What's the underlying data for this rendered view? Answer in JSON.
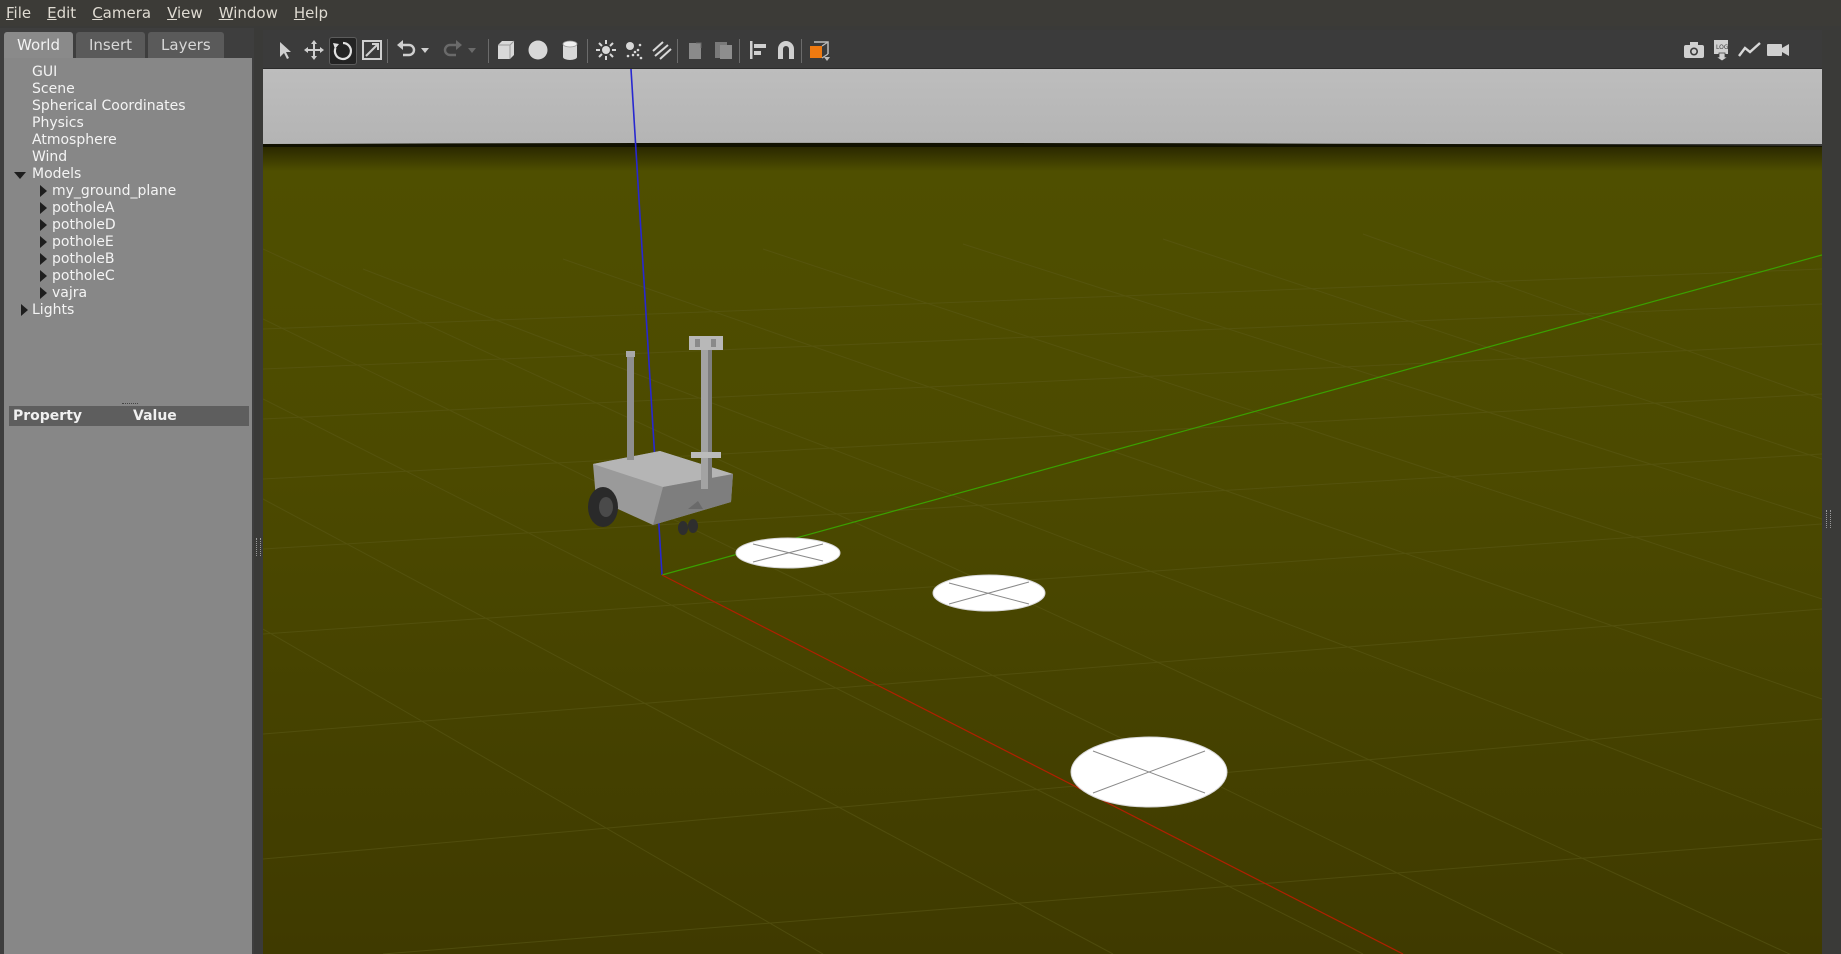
{
  "menu": [
    "File",
    "Edit",
    "Camera",
    "View",
    "Window",
    "Help"
  ],
  "left_panel": {
    "tabs": [
      "World",
      "Insert",
      "Layers"
    ],
    "active_tab": "World",
    "tree": {
      "gui": "GUI",
      "scene": "Scene",
      "spherical": "Spherical Coordinates",
      "physics": "Physics",
      "atmosphere": "Atmosphere",
      "wind": "Wind",
      "models": "Models",
      "model_items": [
        "my_ground_plane",
        "potholeA",
        "potholeD",
        "potholeE",
        "potholeB",
        "potholeC",
        "vajra"
      ],
      "lights": "Lights"
    },
    "property_header": {
      "property": "Property",
      "value": "Value"
    }
  },
  "toolbar": {
    "tools": [
      "select-mode",
      "translate-mode",
      "rotate-mode",
      "scale-mode",
      "undo",
      "undo-history",
      "redo",
      "redo-history",
      "box",
      "sphere",
      "cylinder",
      "point-light",
      "spot-light",
      "directional-light",
      "copy",
      "paste",
      "align",
      "snap",
      "change-view"
    ],
    "active_tool": "rotate-mode",
    "right_tools": [
      "screenshot",
      "log",
      "plot",
      "record-video"
    ]
  },
  "scene": {
    "sky_color": "#b9b9b9",
    "ground_color": "#4a4a00",
    "x_axis_color": "#b02000",
    "y_axis_color": "#2fa000",
    "z_axis_color": "#1a1ad0"
  }
}
